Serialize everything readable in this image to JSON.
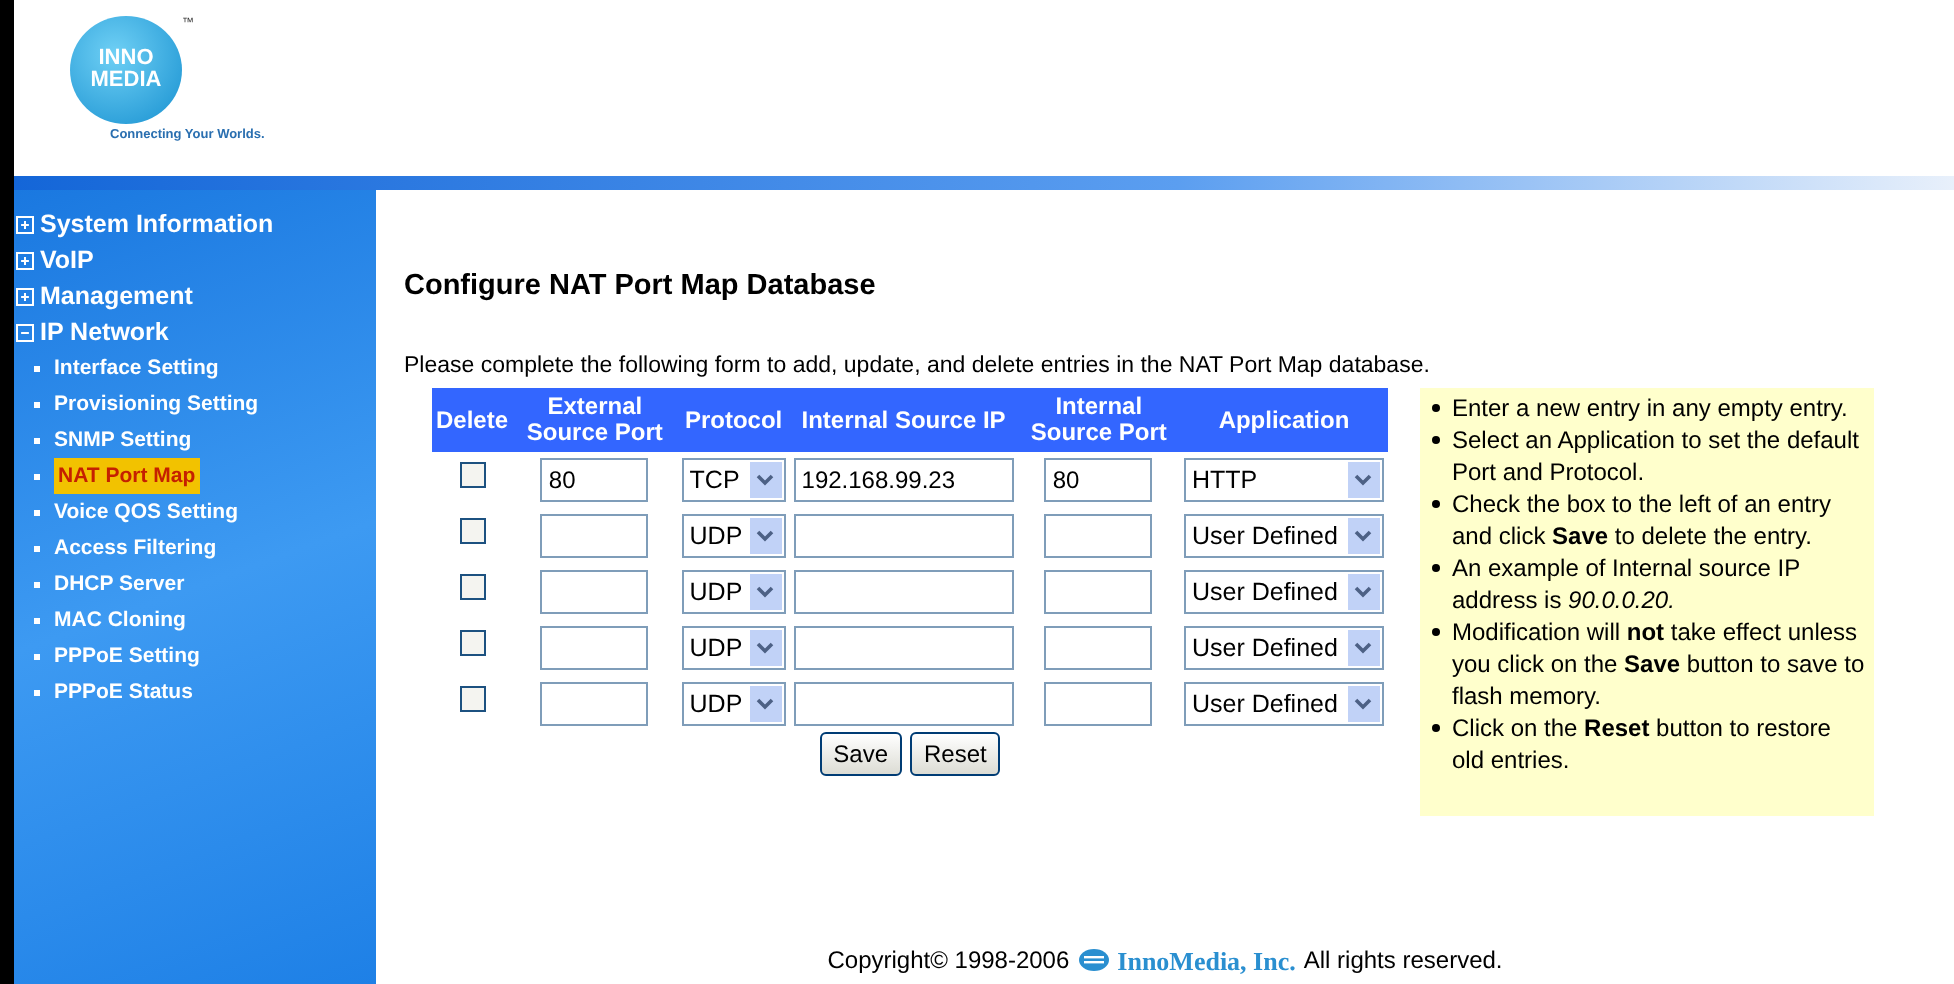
{
  "logo": {
    "lines": [
      "INNO",
      "MEDIA"
    ],
    "trademark": "™",
    "tagline": "Connecting Your Worlds."
  },
  "sidebar": {
    "items": [
      {
        "label": "System Information",
        "expanded": false
      },
      {
        "label": "VoIP",
        "expanded": false
      },
      {
        "label": "Management",
        "expanded": false
      },
      {
        "label": "IP Network",
        "expanded": true,
        "children": [
          {
            "label": "Interface Setting",
            "selected": false
          },
          {
            "label": "Provisioning Setting",
            "selected": false
          },
          {
            "label": "SNMP Setting",
            "selected": false
          },
          {
            "label": "NAT Port Map",
            "selected": true
          },
          {
            "label": "Voice QOS Setting",
            "selected": false
          },
          {
            "label": "Access Filtering",
            "selected": false
          },
          {
            "label": "DHCP Server",
            "selected": false
          },
          {
            "label": "MAC Cloning",
            "selected": false
          },
          {
            "label": "PPPoE Setting",
            "selected": false
          },
          {
            "label": "PPPoE Status",
            "selected": false
          }
        ]
      }
    ]
  },
  "page": {
    "title": "Configure NAT Port Map Database",
    "intro": "Please complete the following form to add, update, and delete entries in the NAT Port Map database."
  },
  "table": {
    "columns": [
      "Delete",
      "External Source Port",
      "Protocol",
      "Internal Source IP",
      "Internal Source Port",
      "Application"
    ],
    "rows": [
      {
        "delete": false,
        "external_port": "80",
        "protocol": "TCP",
        "internal_ip": "192.168.99.23",
        "internal_port": "80",
        "application": "HTTP"
      },
      {
        "delete": false,
        "external_port": "",
        "protocol": "UDP",
        "internal_ip": "",
        "internal_port": "",
        "application": "User Defined"
      },
      {
        "delete": false,
        "external_port": "",
        "protocol": "UDP",
        "internal_ip": "",
        "internal_port": "",
        "application": "User Defined"
      },
      {
        "delete": false,
        "external_port": "",
        "protocol": "UDP",
        "internal_ip": "",
        "internal_port": "",
        "application": "User Defined"
      },
      {
        "delete": false,
        "external_port": "",
        "protocol": "UDP",
        "internal_ip": "",
        "internal_port": "",
        "application": "User Defined"
      }
    ]
  },
  "buttons": [
    "Save",
    "Reset"
  ],
  "help": [
    "Enter a new entry in any empty entry.",
    "Select an Application to set the default Port and Protocol.",
    "Check the box to the left of an entry and click **Save** to delete the entry.",
    "An example of Internal source IP address is *90.0.0.20.*",
    "Modification will **not** take effect unless you click on the **Save** button to save to flash memory.",
    "Click on the **Reset** button to restore old entries."
  ],
  "footer": {
    "copyright": "Copyright© 1998-2006",
    "company": "InnoMedia, Inc.",
    "rights": "All rights reserved."
  }
}
